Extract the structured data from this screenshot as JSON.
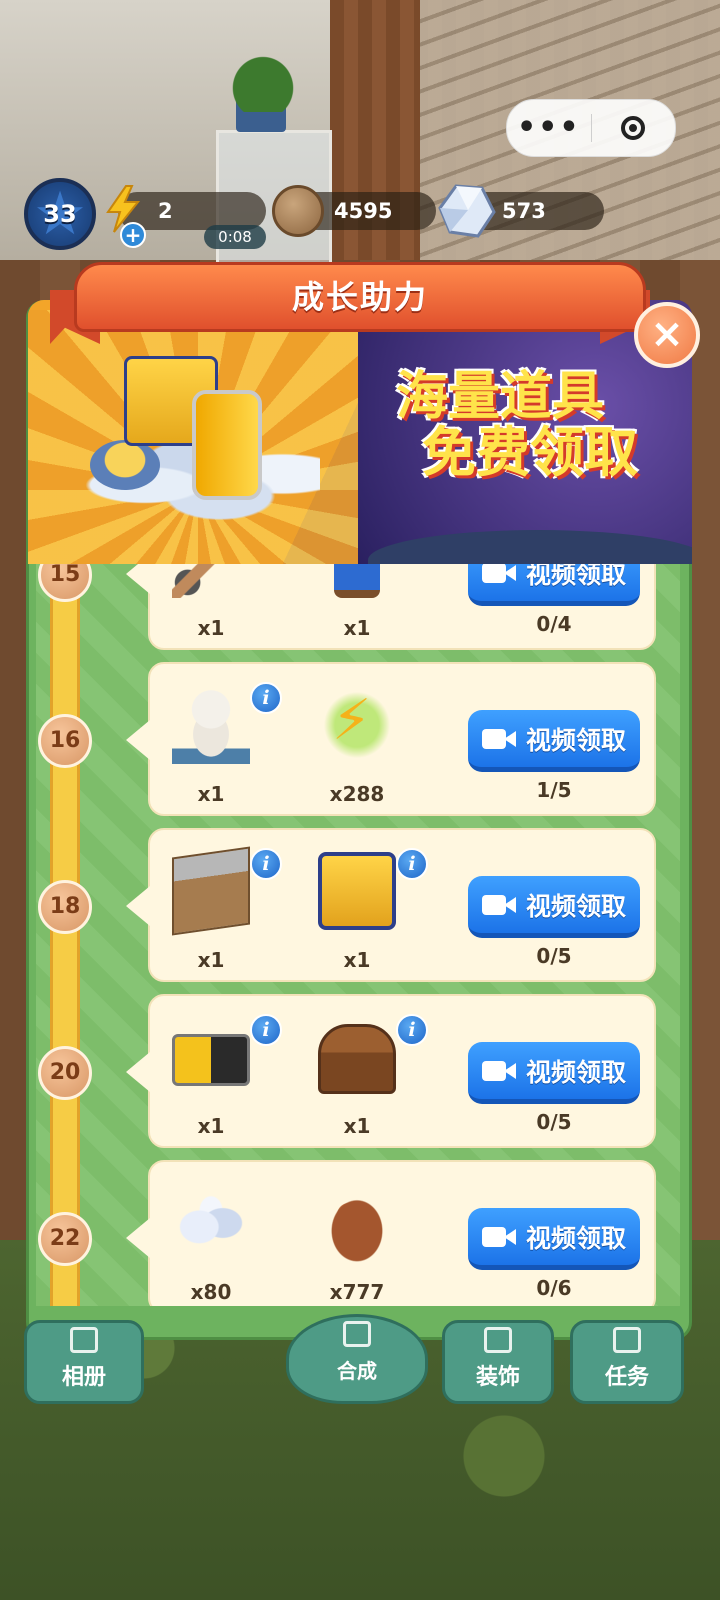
{
  "hud": {
    "level": "33",
    "energy": "2",
    "energy_timer": "0:08",
    "coins": "4595",
    "gems": "573"
  },
  "capsule": {
    "menu": "•••"
  },
  "modal": {
    "title": "成长助力",
    "promo_line1": "海量道具",
    "promo_line2": "免费领取",
    "close_icon": "×"
  },
  "rows": [
    {
      "level": "15",
      "item1_qty": "x1",
      "item2_qty": "x1",
      "button": "视频领取",
      "progress": "0/4"
    },
    {
      "level": "16",
      "item1_qty": "x1",
      "item2_qty": "x288",
      "button": "视频领取",
      "progress": "1/5"
    },
    {
      "level": "18",
      "item1_qty": "x1",
      "item2_qty": "x1",
      "button": "视频领取",
      "progress": "0/5"
    },
    {
      "level": "20",
      "item1_qty": "x1",
      "item2_qty": "x1",
      "button": "视频领取",
      "progress": "0/5"
    },
    {
      "level": "22",
      "item1_qty": "x80",
      "item2_qty": "x777",
      "button": "视频领取",
      "progress": "0/6"
    }
  ],
  "info_glyph": "i",
  "nav": {
    "album": "相册",
    "merge": "合成",
    "decor": "装饰",
    "task": "任务"
  },
  "colors": {
    "modal_green": "#6db35f",
    "button_blue": "#1c73e8",
    "ribbon_orange": "#e0502d",
    "card_cream": "#fff7e0"
  }
}
